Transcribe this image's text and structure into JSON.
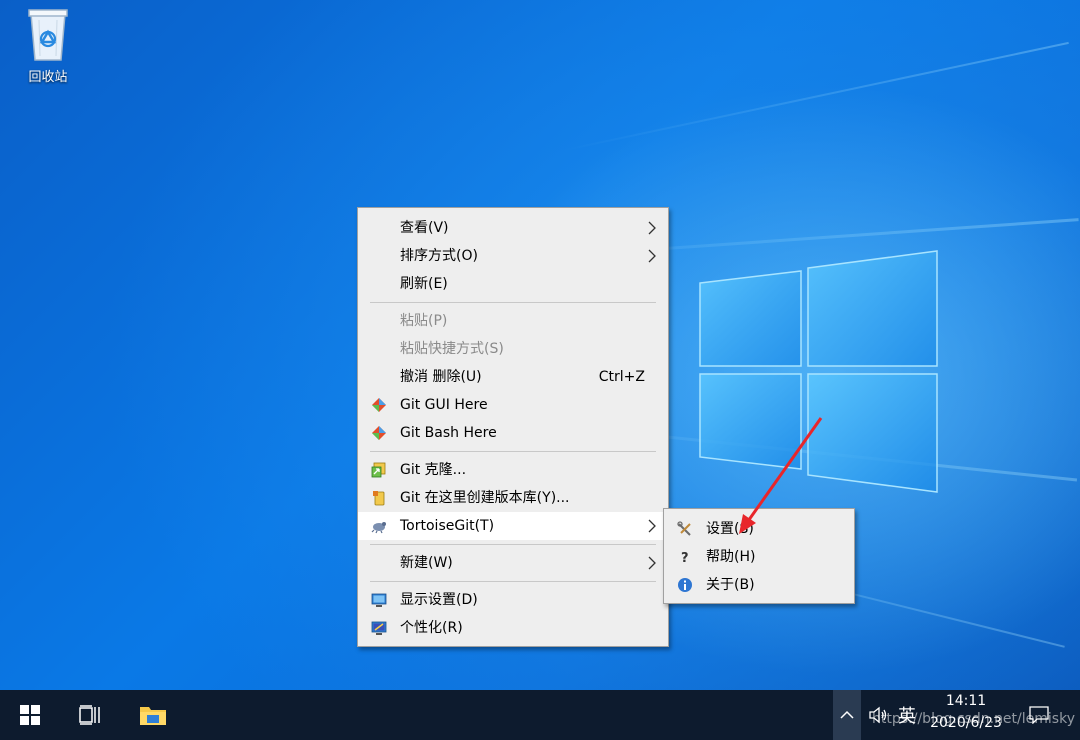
{
  "desktop": {
    "recycle_bin_label": "回收站"
  },
  "context_menu": {
    "items": [
      {
        "label": "查看(V)"
      },
      {
        "label": "排序方式(O)"
      },
      {
        "label": "刷新(E)"
      },
      {
        "label": "粘贴(P)"
      },
      {
        "label": "粘贴快捷方式(S)"
      },
      {
        "label": "撤消 删除(U)",
        "shortcut": "Ctrl+Z"
      },
      {
        "label": "Git GUI Here"
      },
      {
        "label": "Git Bash Here"
      },
      {
        "label": "Git 克隆..."
      },
      {
        "label": "Git 在这里创建版本库(Y)..."
      },
      {
        "label": "TortoiseGit(T)"
      },
      {
        "label": "新建(W)"
      },
      {
        "label": "显示设置(D)"
      },
      {
        "label": "个性化(R)"
      }
    ]
  },
  "submenu": {
    "items": [
      {
        "label": "设置(S)"
      },
      {
        "label": "帮助(H)"
      },
      {
        "label": "关于(B)"
      }
    ]
  },
  "taskbar": {
    "ime_label": "英",
    "time": "14:11",
    "date": "2020/6/23"
  },
  "watermark": "https://blog.csdn.net/lemisky",
  "colors": {
    "annotation_arrow": "#e8262b",
    "taskbar": "#0d1b2e",
    "menu_bg": "#eeeeee"
  }
}
